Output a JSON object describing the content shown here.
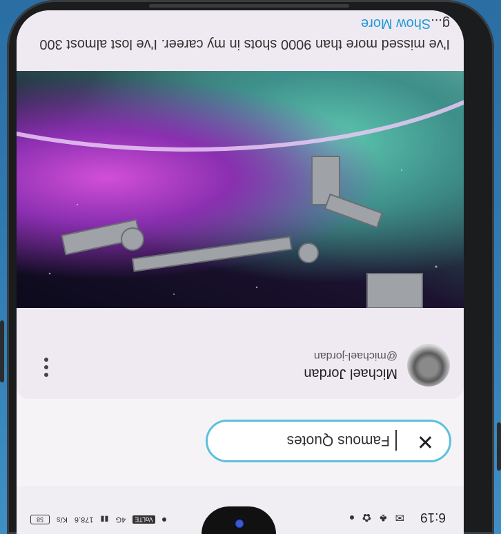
{
  "status_bar": {
    "time": "6:19",
    "speed": "178.6",
    "speed_unit": "K/s",
    "network": "VoLTE",
    "network_gen": "4G",
    "battery": "58"
  },
  "search": {
    "query": "Famous Quotes",
    "clear_icon": "close-icon"
  },
  "post": {
    "author_name": "Michael Jordan",
    "author_handle": "@michael-jordan",
    "text": "I've missed more than 9000 shots in my career. I've lost almost 300 g...",
    "show_more": "Show More"
  },
  "colors": {
    "accent": "#5bc0dc",
    "link": "#1e9ad6",
    "card_bg": "#efeaf2"
  }
}
